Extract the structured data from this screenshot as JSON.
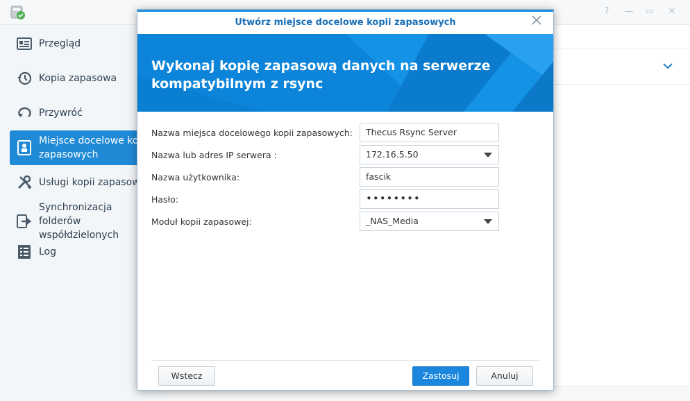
{
  "sidebar": {
    "items": [
      {
        "label": "Przegląd",
        "icon": "overview-icon"
      },
      {
        "label": "Kopia zapasowa",
        "icon": "backup-history-icon"
      },
      {
        "label": "Przywróć",
        "icon": "restore-icon"
      },
      {
        "label_line1": "Miejsce docelowe ko",
        "label_line2": "zapasowych",
        "icon": "destination-icon",
        "active": true
      },
      {
        "label": "Usługi kopii zapasow",
        "icon": "tools-icon"
      },
      {
        "label_line1": "Synchronizacja",
        "label_line2": "folderów",
        "label_line3": "współdzielonych",
        "icon": "sync-folders-icon"
      },
      {
        "label": "Log",
        "icon": "log-icon"
      }
    ]
  },
  "modal": {
    "title": "Utwórz miejsce docelowe kopii zapasowych",
    "banner_line1": "Wykonaj kopię zapasową danych na serwerze",
    "banner_line2": "kompatybilnym z rsync",
    "fields": {
      "destination_name": {
        "label": "Nazwa miejsca docelowego kopii zapasowych:",
        "value": "Thecus Rsync Server"
      },
      "server": {
        "label": "Nazwa lub adres IP serwera :",
        "value": "172.16.5.50"
      },
      "username": {
        "label": "Nazwa użytkownika:",
        "value": "fascik"
      },
      "password": {
        "label": "Hasło:",
        "value": "••••••••"
      },
      "module": {
        "label": "Moduł kopii zapasowej:",
        "value": "_NAS_Media"
      }
    },
    "buttons": {
      "back": "Wstecz",
      "apply": "Zastosuj",
      "cancel": "Anuluj"
    }
  },
  "colors": {
    "accent": "#1f8ad6",
    "banner": "#0d86db",
    "title_text": "#1a6fb6"
  }
}
